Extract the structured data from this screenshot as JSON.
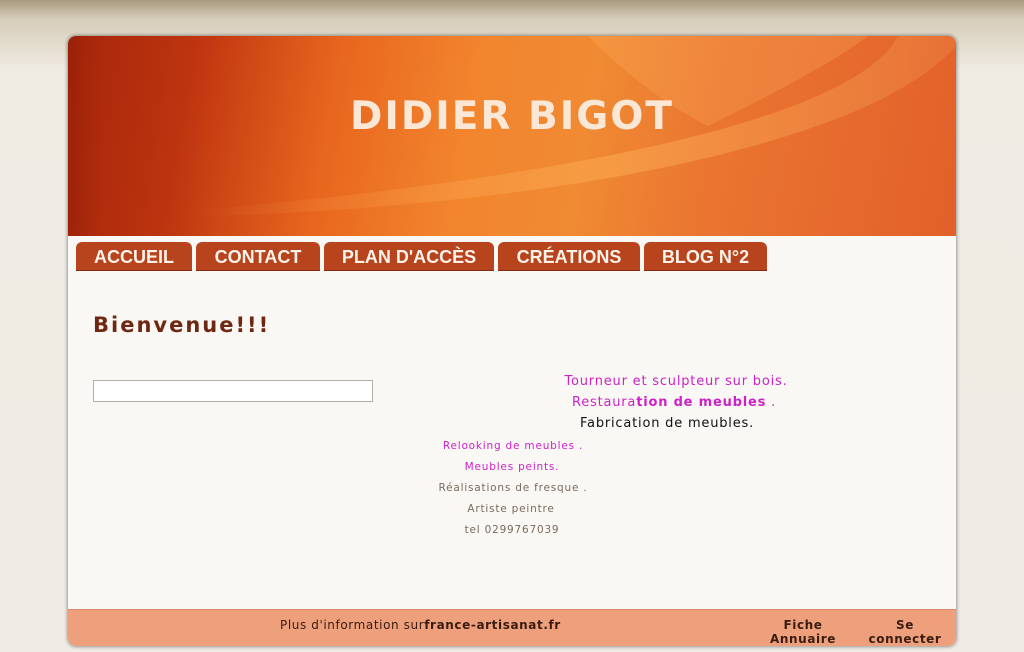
{
  "site": {
    "title": "DIDIER BIGOT"
  },
  "nav": {
    "items": [
      {
        "label": "ACCUEIL"
      },
      {
        "label": "CONTACT"
      },
      {
        "label": "PLAN D'ACCÈS"
      },
      {
        "label": "CRÉATIONS"
      },
      {
        "label": "BLOG N°2"
      }
    ]
  },
  "main": {
    "heading": "Bienvenue!!!",
    "lines": {
      "tourneur": "Tourneur et sculpteur sur bois.",
      "restau_a": "Restaura",
      "restau_b": "tion de meubles",
      "restau_c": " .",
      "fabrication": "Fabrication de meubles.",
      "relooking": "Relooking de meubles .",
      "peints": "Meubles peints.",
      "fresque": "Réalisations de fresque .",
      "artiste": "Artiste peintre",
      "tel": "tel 0299767039"
    }
  },
  "footer": {
    "info_prefix": "Plus d'information sur",
    "info_link": "france-artisanat.fr",
    "fiche_line1": "Fiche",
    "fiche_line2": "Annuaire",
    "connect_line1": "Se",
    "connect_line2": "connecter"
  },
  "colors": {
    "nav_tab": "#b7441c",
    "heading": "#6e2812",
    "accent_magenta": "#cc22c8",
    "footer_bg": "#ee9f7c"
  }
}
